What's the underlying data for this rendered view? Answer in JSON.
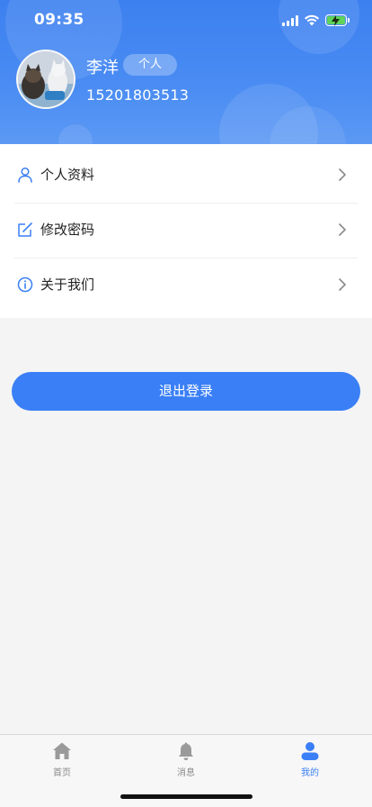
{
  "status_bar": {
    "time": "09:35"
  },
  "profile": {
    "name": "李洋",
    "tag": "个人",
    "phone": "15201803513"
  },
  "menu": {
    "items": [
      {
        "label": "个人资料",
        "icon": "user-icon"
      },
      {
        "label": "修改密码",
        "icon": "edit-icon"
      },
      {
        "label": "关于我们",
        "icon": "info-icon"
      }
    ]
  },
  "logout_label": "退出登录",
  "tabbar": {
    "tabs": [
      {
        "label": "首页",
        "icon": "home-icon",
        "active": false
      },
      {
        "label": "消息",
        "icon": "bell-icon",
        "active": false
      },
      {
        "label": "我的",
        "icon": "person-icon",
        "active": true
      }
    ]
  },
  "colors": {
    "accent": "#3a7ff6",
    "header": "#4a8cf3",
    "background": "#f4f4f4",
    "inactive_tab": "#8a8a8a"
  }
}
